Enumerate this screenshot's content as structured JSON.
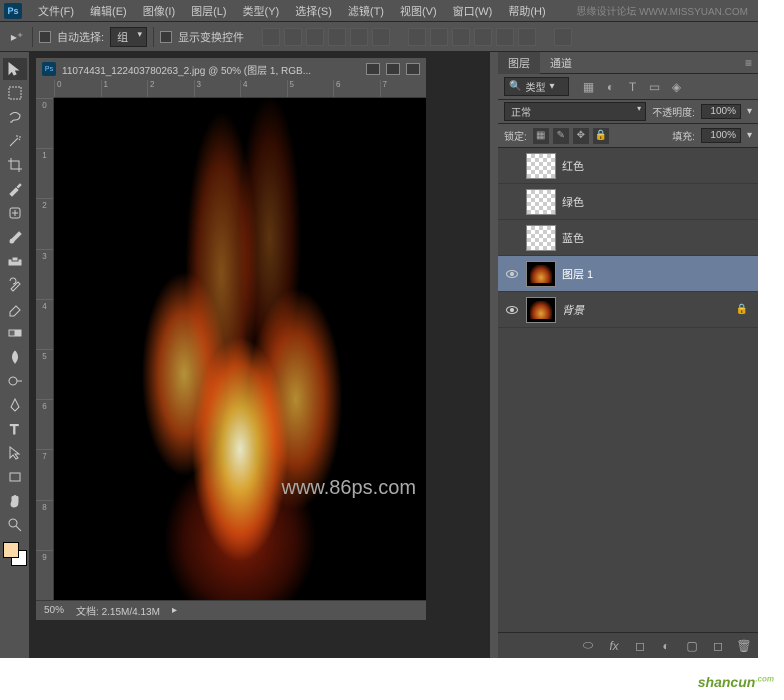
{
  "branding": {
    "site_label": "思缘设计论坛",
    "site_url": "WWW.MISSYUAN.COM"
  },
  "menubar": {
    "items": [
      "文件(F)",
      "编辑(E)",
      "图像(I)",
      "图层(L)",
      "类型(Y)",
      "选择(S)",
      "滤镜(T)",
      "视图(V)",
      "窗口(W)",
      "帮助(H)"
    ]
  },
  "options": {
    "auto_select_label": "自动选择:",
    "group_label": "组",
    "show_transform_label": "显示变换控件"
  },
  "document": {
    "title": "11074431_122403780263_2.jpg @ 50% (图层 1, RGB...",
    "zoom": "50%",
    "doc_info": "文档: 2.15M/4.13M"
  },
  "ruler": {
    "h": [
      "0",
      "1",
      "2",
      "3",
      "4",
      "5",
      "6",
      "7"
    ],
    "v": [
      "0",
      "1",
      "2",
      "3",
      "4",
      "5",
      "6",
      "7",
      "8",
      "9"
    ]
  },
  "watermark": "www.86ps.com",
  "panels": {
    "layers_tab": "图层",
    "channels_tab": "通道",
    "filter_kind": "类型",
    "blend_mode": "正常",
    "opacity_label": "不透明度:",
    "opacity_value": "100%",
    "lock_label": "锁定:",
    "fill_label": "填充:",
    "fill_value": "100%",
    "layers": [
      {
        "name": "红色",
        "visible": false,
        "thumb": "trans",
        "selected": false
      },
      {
        "name": "绿色",
        "visible": false,
        "thumb": "trans",
        "selected": false
      },
      {
        "name": "蓝色",
        "visible": false,
        "thumb": "trans",
        "selected": false
      },
      {
        "name": "图层 1",
        "visible": true,
        "thumb": "fire",
        "selected": true
      },
      {
        "name": "背景",
        "visible": true,
        "thumb": "fire",
        "selected": false,
        "locked": true,
        "italic": true
      }
    ]
  },
  "bottom_logo": "shancun"
}
